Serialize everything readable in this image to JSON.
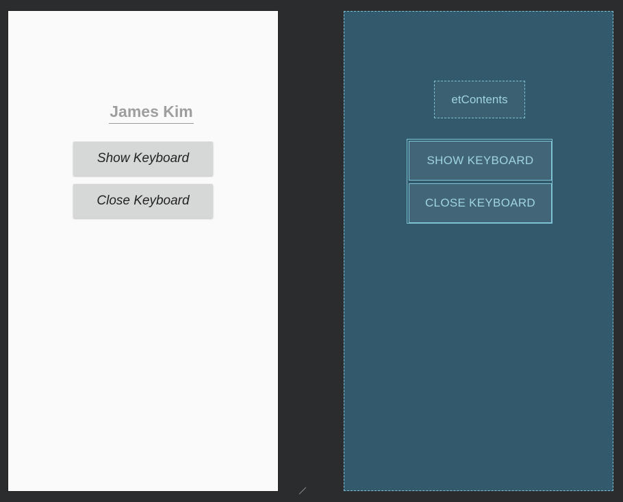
{
  "design": {
    "edit_text_value": "James Kim",
    "show_button_label": "Show Keyboard",
    "close_button_label": "Close Keyboard"
  },
  "blueprint": {
    "edit_text_id": "etContents",
    "show_button_label": "SHOW KEYBOARD",
    "close_button_label": "CLOSE KEYBOARD"
  },
  "colors": {
    "canvas_bg": "#2b2c2e",
    "design_bg": "#fafafa",
    "blueprint_bg": "#325a6c",
    "blueprint_accent": "#7fc4d6",
    "button_bg": "#d6d7d7"
  }
}
